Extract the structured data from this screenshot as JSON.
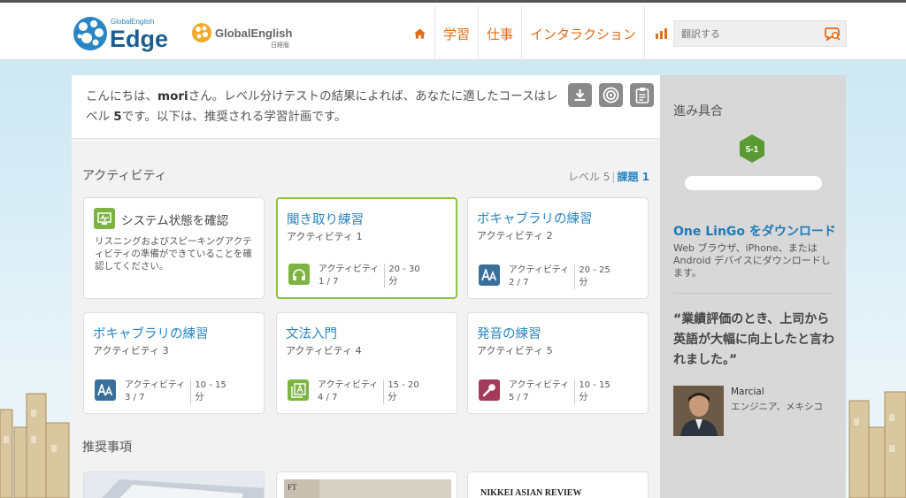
{
  "header": {
    "brand_edge": "Edge",
    "brand_edge_small": "GlobalEnglish",
    "brand_ge": "GlobalEnglish",
    "brand_ge_sub": "日経版",
    "nav": [
      {
        "label": "学習"
      },
      {
        "label": "仕事"
      },
      {
        "label": "インタラクション"
      }
    ],
    "search_placeholder": "翻訳する",
    "accent_color": "#e26d1a"
  },
  "greeting": {
    "prefix": "こんにちは、",
    "name": "mori",
    "middle": "さん。レベル分けテストの結果によれば、あなたに適したコースはレベル ",
    "level": "5",
    "suffix": "です。以下は、推奨される学習計画です。",
    "icons": [
      "download-icon",
      "target-icon",
      "clipboard-icon"
    ]
  },
  "activities": {
    "title": "アクティビティ",
    "level_label": "レベル 5",
    "lesson_label": "課題 1",
    "system_check": {
      "title": "システム状態を確認",
      "description": "リスニングおよびスピーキングアクティビティの準備ができていることを確認してください。"
    },
    "stat_label": "アクティビティ",
    "cards": [
      {
        "title": "聞き取り練習",
        "subtitle": "アクティビティ 1",
        "progress": "1 / 7",
        "time": "20 - 30",
        "unit": "分",
        "icon": "headphones-icon",
        "color": "#7cb342"
      },
      {
        "title": "ボキャブラリの練習",
        "subtitle": "アクティビティ 2",
        "progress": "2 / 7",
        "time": "20 - 25",
        "unit": "分",
        "icon": "vocabulary-icon",
        "color": "#3a6f9c"
      },
      {
        "title": "ボキャブラリの練習",
        "subtitle": "アクティビティ 3",
        "progress": "3 / 7",
        "time": "10 - 15",
        "unit": "分",
        "icon": "vocabulary-icon",
        "color": "#3a6f9c"
      },
      {
        "title": "文法入門",
        "subtitle": "アクティビティ 4",
        "progress": "4 / 7",
        "time": "15 - 20",
        "unit": "分",
        "icon": "grammar-icon",
        "color": "#7cb342"
      },
      {
        "title": "発音の練習",
        "subtitle": "アクティビティ 5",
        "progress": "5 / 7",
        "time": "10 - 15",
        "unit": "分",
        "icon": "microphone-icon",
        "color": "#a33a5a"
      }
    ]
  },
  "recommendations": {
    "title": "推奨事項",
    "items": [
      "FT",
      "NIKKEI ASIAN REVIEW"
    ]
  },
  "sidebar": {
    "progress_title": "進み具合",
    "level_badge": "5-1",
    "progress_fraction": 0,
    "lingo_title": "One LinGo をダウンロード",
    "lingo_desc": "Web ブラウザ、iPhone、または Android デバイスにダウンロードします。",
    "quote": "“業績評価のとき、上司から英語が大幅に向上したと言われました。”",
    "person_name": "Marcial",
    "person_role": "エンジニア、メキシコ"
  }
}
